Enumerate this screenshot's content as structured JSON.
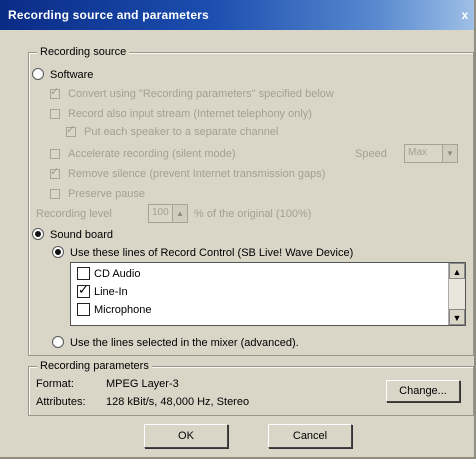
{
  "window": {
    "title": "Recording source and parameters",
    "close_glyph": "x"
  },
  "source_group": {
    "legend": "Recording source"
  },
  "software": {
    "label": "Software"
  },
  "options": {
    "convert": "Convert using \"Recording parameters\" specified below",
    "record_input": "Record also input stream (Internet telephony only)",
    "separate_channel": "Put each speaker to a separate channel",
    "accelerate": "Accelerate recording (silent mode)",
    "speed_label": "Speed",
    "speed_value": "Max",
    "remove_silence": "Remove silence (prevent Internet transmission gaps)",
    "preserve_pause": "Preserve pause",
    "level_label": "Recording level",
    "level_value": "100",
    "level_suffix": "% of the original (100%)"
  },
  "sound_board": {
    "label": "Sound board",
    "use_lines": "Use these lines of Record Control (SB Live! Wave Device)",
    "lines": [
      {
        "label": "CD Audio",
        "checked": false
      },
      {
        "label": "Line-In",
        "checked": true
      },
      {
        "label": "Microphone",
        "checked": false
      }
    ],
    "use_mixer": "Use the lines selected in the mixer (advanced)."
  },
  "params": {
    "legend": "Recording parameters",
    "format_label": "Format:",
    "format_value": "MPEG Layer-3",
    "attributes_label": "Attributes:",
    "attributes_value": "128 kBit/s, 48,000 Hz, Stereo",
    "change_button": "Change..."
  },
  "footer": {
    "ok": "OK",
    "cancel": "Cancel"
  }
}
